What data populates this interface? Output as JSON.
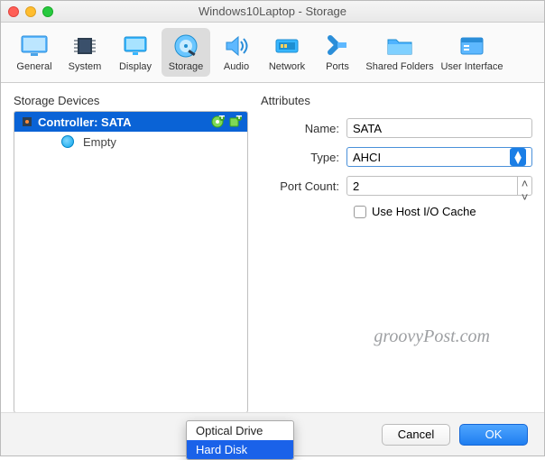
{
  "window": {
    "title": "Windows10Laptop - Storage"
  },
  "toolbar": {
    "items": [
      {
        "label": "General"
      },
      {
        "label": "System"
      },
      {
        "label": "Display"
      },
      {
        "label": "Storage"
      },
      {
        "label": "Audio"
      },
      {
        "label": "Network"
      },
      {
        "label": "Ports"
      },
      {
        "label": "Shared Folders"
      },
      {
        "label": "User Interface"
      }
    ],
    "selected": "Storage"
  },
  "left_panel": {
    "heading": "Storage Devices",
    "controller_row": "Controller: SATA",
    "child_empty": "Empty"
  },
  "right_panel": {
    "heading": "Attributes",
    "name_label": "Name:",
    "name_value": "SATA",
    "type_label": "Type:",
    "type_value": "AHCI",
    "portcount_label": "Port Count:",
    "portcount_value": "2",
    "hostio_label": "Use Host I/O Cache"
  },
  "popup": {
    "item1": "Optical Drive",
    "item2": "Hard Disk"
  },
  "buttons": {
    "cancel": "Cancel",
    "ok": "OK"
  },
  "watermark": "groovyPost.com"
}
